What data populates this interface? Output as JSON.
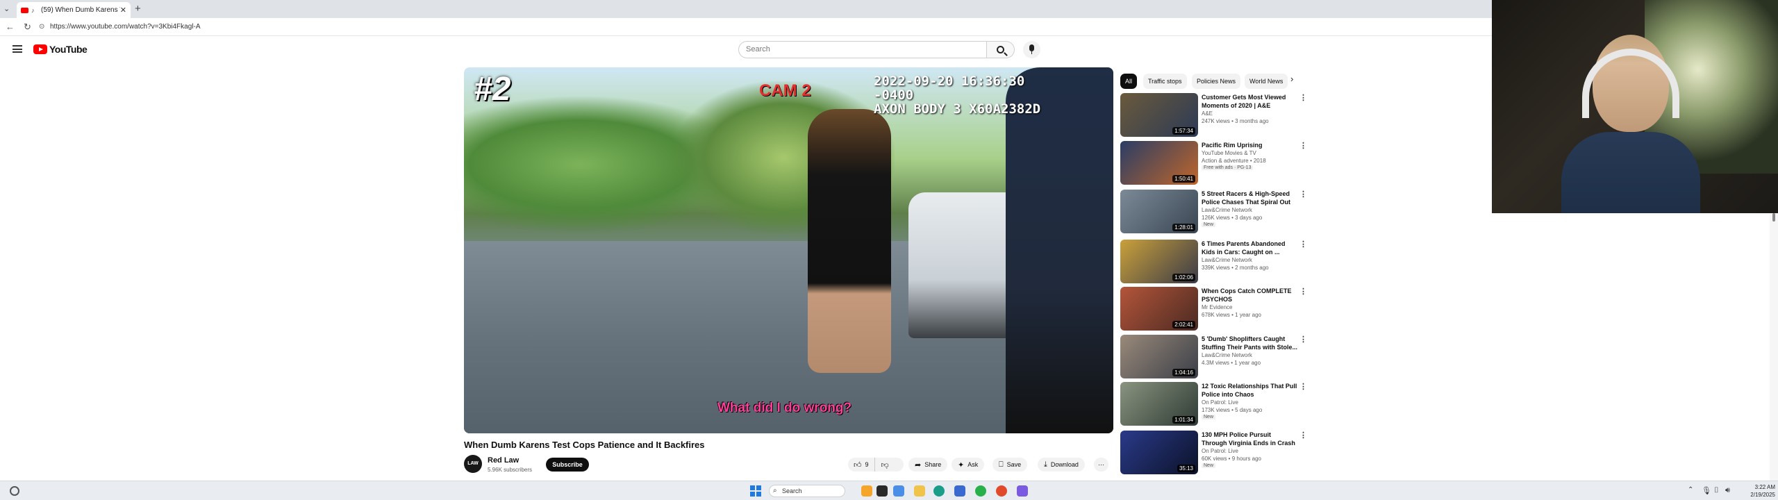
{
  "browser": {
    "tab_title": "(59) When Dumb Karens Te...",
    "tab_close": "✕",
    "new_tab": "+",
    "tab_list": "⌄",
    "url": "https://www.youtube.com/watch?v=3Kbi4Fkagl-A",
    "back": "←",
    "forward": "→",
    "reload": "↻"
  },
  "header": {
    "logo_text": "YouTube",
    "search_placeholder": "Search"
  },
  "video": {
    "overlay_rank": "#2",
    "overlay_cam": "CAM 2",
    "overlay_timestamp": "2022-09-20 16:36:30 -0400",
    "overlay_device": "AXON BODY 3 X60A2382D",
    "caption": "What did I do wrong?",
    "title": "When Dumb Karens Test Cops Patience and It Backfires",
    "channel_name": "Red Law",
    "channel_subs": "5.96K subscribers",
    "channel_avatar_text": "LAW",
    "subscribe_label": "Subscribe",
    "like_count": "9",
    "share_label": "Share",
    "ask_label": "Ask",
    "save_label": "Save",
    "download_label": "Download",
    "more_label": "⋯"
  },
  "sidebar": {
    "chips": [
      "All",
      "Traffic stops",
      "Policies News",
      "World News"
    ],
    "chip_next": "›",
    "items": [
      {
        "title": "Customer Gets Most Viewed Moments of 2020 | A&E",
        "channel": "A&E",
        "meta": "247K views • 3 months ago",
        "duration": "1:57:34",
        "badge": "",
        "color1": "#6a5a3c",
        "color2": "#2c3a55"
      },
      {
        "title": "Pacific Rim Uprising",
        "channel": "YouTube Movies & TV",
        "meta": "Action & adventure • 2018",
        "duration": "1:50:41",
        "badge": "Free with ads · PG-13",
        "color1": "#2a3d66",
        "color2": "#c0662a"
      },
      {
        "title": "5 Street Racers & High-Speed Police Chases That Spiral Out ...",
        "channel": "Law&Crime Network",
        "meta": "126K views • 3 days ago",
        "duration": "1:28:01",
        "badge": "New",
        "color1": "#7c8a98",
        "color2": "#3a4652"
      },
      {
        "title": "6 Times Parents Abandoned Kids in Cars: Caught on ...",
        "channel": "Law&Crime Network",
        "meta": "339K views • 2 months ago",
        "duration": "1:02:06",
        "badge": "",
        "color1": "#caa13a",
        "color2": "#3a3a48"
      },
      {
        "title": "When Cops Catch COMPLETE PSYCHOS",
        "channel": "Mr Evidence",
        "meta": "678K views • 1 year ago",
        "duration": "2:02:41",
        "badge": "",
        "color1": "#b4553a",
        "color2": "#4a2a22"
      },
      {
        "title": "5 'Dumb' Shoplifters Caught Stuffing Their Pants with Stole...",
        "channel": "Law&Crime Network",
        "meta": "4.3M views • 1 year ago",
        "duration": "1:04:16",
        "badge": "",
        "color1": "#9a8a7a",
        "color2": "#3a3e48"
      },
      {
        "title": "12 Toxic Relationships That Pull Police into Chaos",
        "channel": "On Patrol: Live",
        "meta": "173K views • 5 days ago",
        "duration": "1:01:34",
        "badge": "New",
        "color1": "#8a9480",
        "color2": "#2e3a34"
      },
      {
        "title": "130 MPH Police Pursuit Through Virginia Ends in Crash",
        "channel": "On Patrol: Live",
        "meta": "60K views • 9 hours ago",
        "duration": "35:13",
        "badge": "New",
        "color1": "#2a3a8a",
        "color2": "#0c1228"
      }
    ]
  },
  "taskbar": {
    "search_label": "Search",
    "time": "3:22 AM",
    "date": "2/19/2025"
  },
  "colors": {
    "brand_red": "#ff0000",
    "caption_pink": "#ff3f9a",
    "cam_red": "#e53030"
  }
}
